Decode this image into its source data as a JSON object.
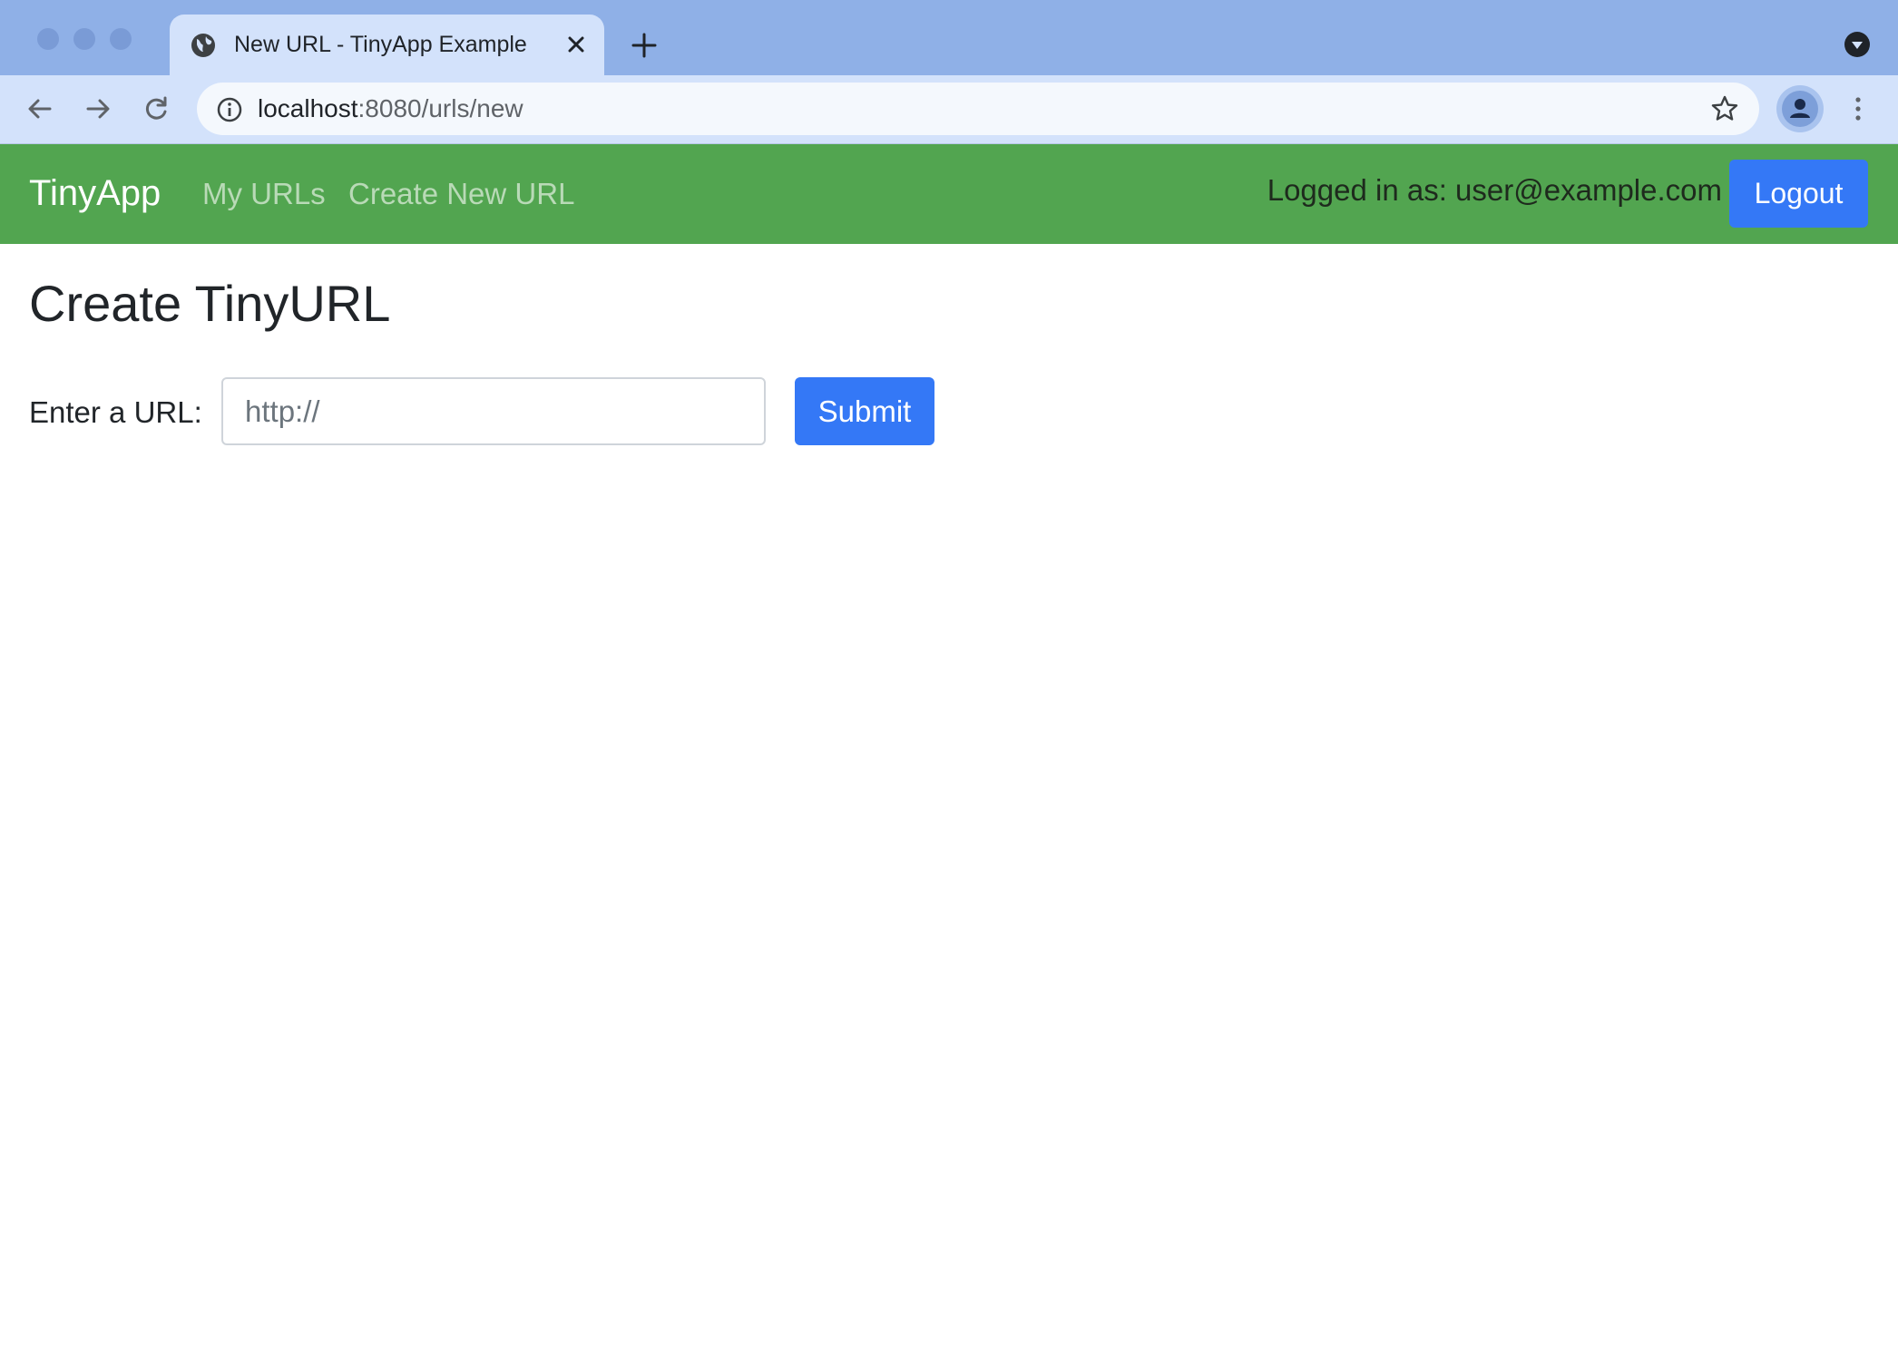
{
  "browser": {
    "tab": {
      "title": "New URL - TinyApp Example",
      "icon": "globe-icon"
    },
    "address_bar": {
      "host": "localhost",
      "path": ":8080/urls/new"
    },
    "colors": {
      "tabstrip": "#8fb0e7",
      "toolbar": "#d3e2fb"
    }
  },
  "navbar": {
    "brand": "TinyApp",
    "links": [
      "My URLs",
      "Create New URL"
    ],
    "logged_in_text": "Logged in as: user@example.com",
    "logout_label": "Logout",
    "colors": {
      "background": "#52a550",
      "button": "#3478f6"
    }
  },
  "main": {
    "title": "Create TinyURL",
    "form": {
      "label": "Enter a URL:",
      "placeholder": "http://",
      "value": "",
      "submit_label": "Submit"
    }
  }
}
